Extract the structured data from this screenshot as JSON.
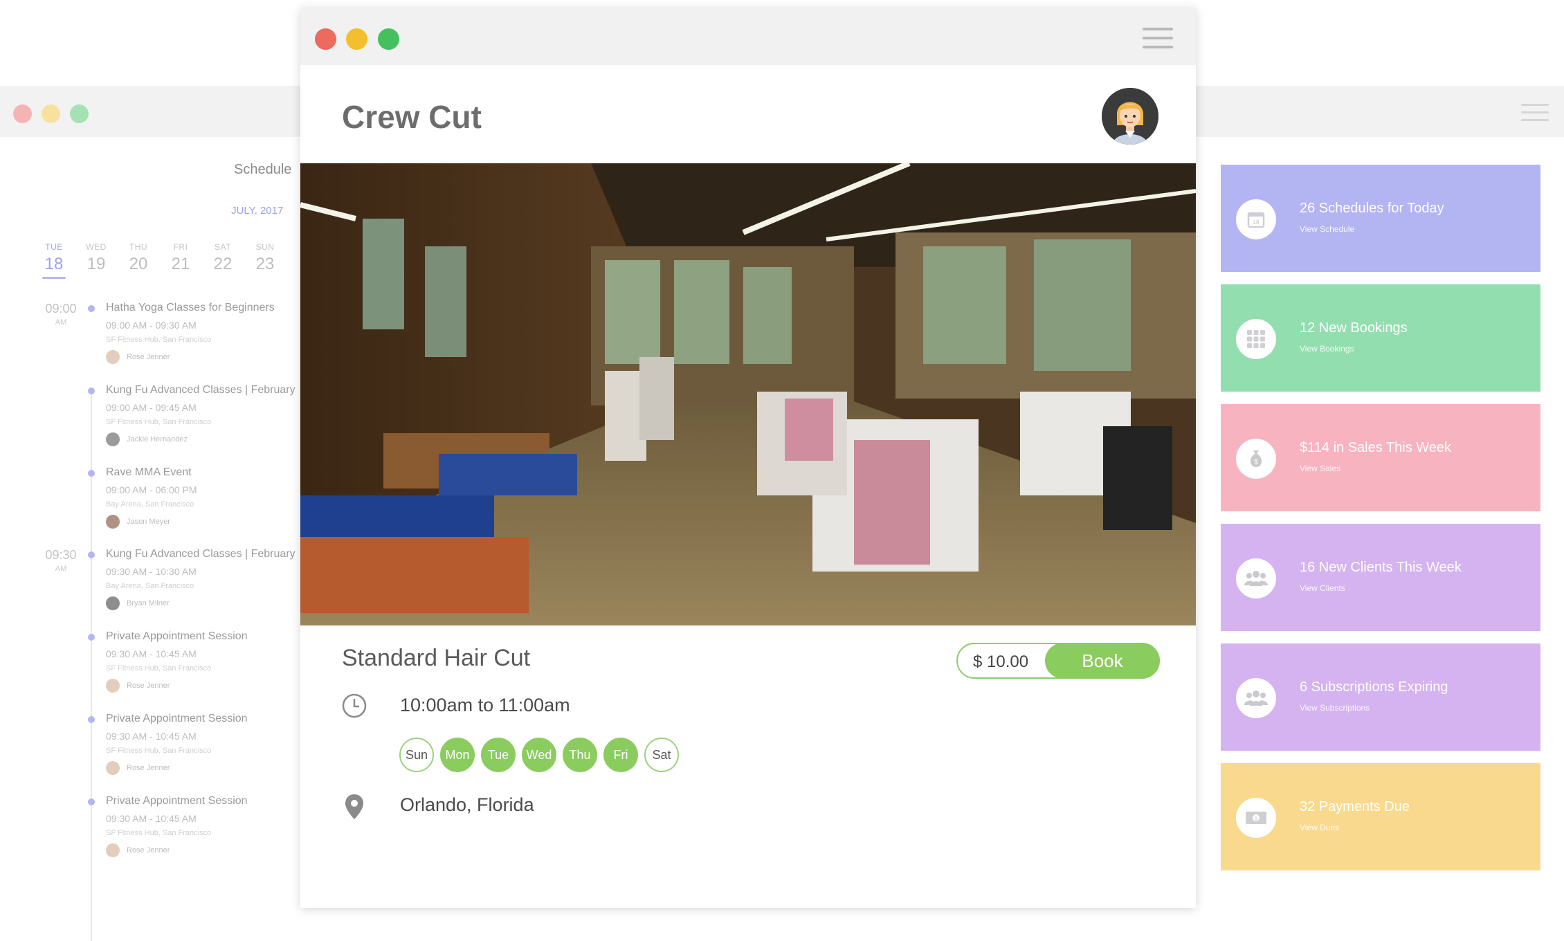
{
  "schedule": {
    "title": "Schedule",
    "month": "JULY, 2017",
    "days": [
      {
        "name": "TUE",
        "date": "18"
      },
      {
        "name": "WED",
        "date": "19"
      },
      {
        "name": "THU",
        "date": "20"
      },
      {
        "name": "FRI",
        "date": "21"
      },
      {
        "name": "SAT",
        "date": "22"
      },
      {
        "name": "SUN",
        "date": "23"
      }
    ],
    "times": [
      {
        "time": "09:00",
        "ampm": "AM"
      },
      {
        "time": "09:30",
        "ampm": "AM"
      }
    ],
    "events": [
      {
        "title": "Hatha Yoga Classes for Beginners",
        "time": "09:00 AM - 09:30 AM",
        "place": "SF Fitness Hub, San Francisco",
        "person": "Rose Jenner"
      },
      {
        "title": "Kung Fu Advanced Classes | February",
        "time": "09:00 AM - 09:45 AM",
        "place": "SF Fitness Hub, San Francisco",
        "person": "Jackie Hernandez"
      },
      {
        "title": "Rave MMA Event",
        "time": "09:00 AM - 06:00 PM",
        "place": "Bay Arena, San Francisco",
        "person": "Jason Meyer"
      },
      {
        "title": "Kung Fu Advanced Classes | February",
        "time": "09:30 AM - 10:30 AM",
        "place": "Bay Arena, San Francisco",
        "person": "Bryan Milner"
      },
      {
        "title": "Private Appointment Session",
        "time": "09:30 AM - 10:45 AM",
        "place": "SF Fitness Hub, San Francisco",
        "person": "Rose Jenner"
      },
      {
        "title": "Private Appointment Session",
        "time": "09:30 AM - 10:45 AM",
        "place": "SF Fitness Hub, San Francisco",
        "person": "Rose Jenner"
      },
      {
        "title": "Private Appointment Session",
        "time": "09:30 AM - 10:45 AM",
        "place": "SF Fitness Hub, San Francisco",
        "person": "Rose Jenner"
      }
    ]
  },
  "cards": [
    {
      "title": "26 Schedules for Today",
      "link": "View Schedule",
      "color": "#b3b4f2",
      "icon": "calendar-icon"
    },
    {
      "title": "12 New Bookings",
      "link": "View Bookings",
      "color": "#93deae",
      "icon": "grid-icon"
    },
    {
      "title": "$114 in Sales This Week",
      "link": "View Sales",
      "color": "#f7b3bf",
      "icon": "money-bag-icon"
    },
    {
      "title": "16 New Clients This Week",
      "link": "View Clients",
      "color": "#d5b3f0",
      "icon": "users-icon"
    },
    {
      "title": "6 Subscriptions Expiring",
      "link": "View Subscriptions",
      "color": "#d4b3f0",
      "icon": "users-icon"
    },
    {
      "title": "32 Payments Due",
      "link": "View Dues",
      "color": "#f9d98e",
      "icon": "cash-icon"
    }
  ],
  "detail": {
    "shop_name": "Crew Cut",
    "service": "Standard Hair Cut",
    "price": "$ 10.00",
    "book_label": "Book",
    "time": "10:00am to 11:00am",
    "days": [
      {
        "label": "Sun",
        "on": false
      },
      {
        "label": "Mon",
        "on": true
      },
      {
        "label": "Tue",
        "on": true
      },
      {
        "label": "Wed",
        "on": true
      },
      {
        "label": "Thu",
        "on": true
      },
      {
        "label": "Fri",
        "on": true
      },
      {
        "label": "Sat",
        "on": false
      }
    ],
    "location": "Orlando, Florida"
  },
  "colors": {
    "accent_green": "#8bcc5f",
    "accent_purple": "#9da2ee"
  }
}
